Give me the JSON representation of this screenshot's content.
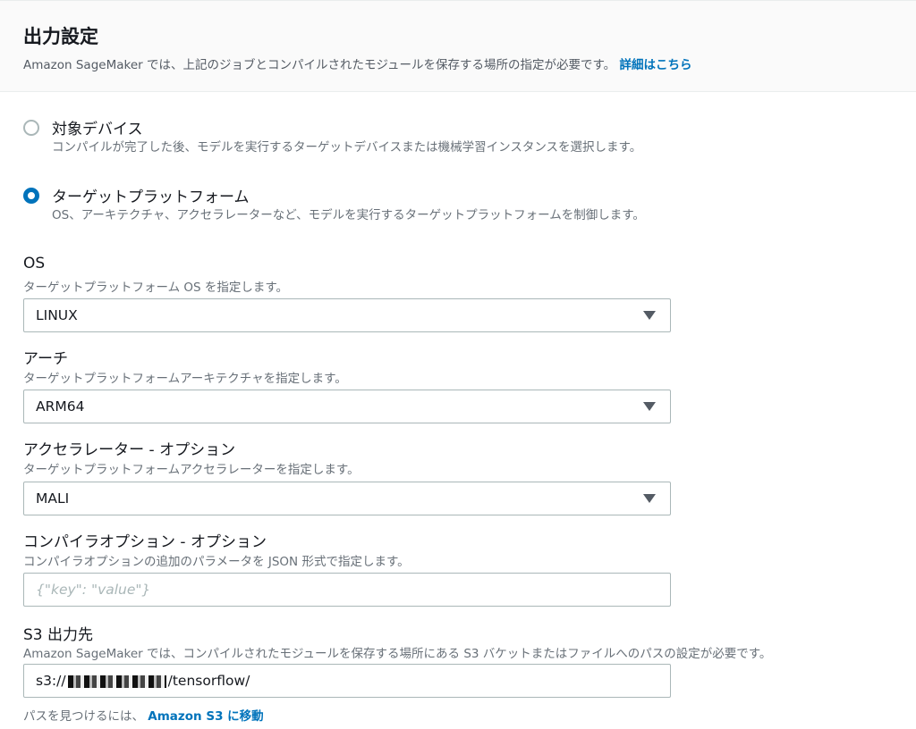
{
  "header": {
    "title": "出力設定",
    "description": "Amazon SageMaker では、上記のジョブとコンパイルされたモジュールを保存する場所の指定が必要です。",
    "learn_more": "詳細はこちら"
  },
  "target_options": [
    {
      "label": "対象デバイス",
      "description": "コンパイルが完了した後、モデルを実行するターゲットデバイスまたは機械学習インスタンスを選択します。",
      "selected": false
    },
    {
      "label": "ターゲットプラットフォーム",
      "description": "OS、アーキテクチャ、アクセラレーターなど、モデルを実行するターゲットプラットフォームを制御します。",
      "selected": true
    }
  ],
  "os": {
    "label": "OS",
    "description": "ターゲットプラットフォーム OS を指定します。",
    "value": "LINUX"
  },
  "arch": {
    "label": "アーチ",
    "description": "ターゲットプラットフォームアーキテクチャを指定します。",
    "value": "ARM64"
  },
  "accelerator": {
    "label": "アクセラレーター - オプション",
    "description": "ターゲットプラットフォームアクセラレーターを指定します。",
    "value": "MALI"
  },
  "compiler_options": {
    "label": "コンパイラオプション - オプション",
    "description": "コンパイラオプションの追加のパラメータを JSON 形式で指定します。",
    "placeholder": "{\"key\": \"value\"}"
  },
  "s3_output": {
    "label": "S3 出力先",
    "description": "Amazon SageMaker では、コンパイルされたモジュールを保存する場所にある S3 バケットまたはファイルへのパスの設定が必要です。",
    "value_prefix": "s3://",
    "value_suffix": "/tensorflow/",
    "help_text": "パスを見つけるには、",
    "help_link": "Amazon S3 に移動"
  }
}
